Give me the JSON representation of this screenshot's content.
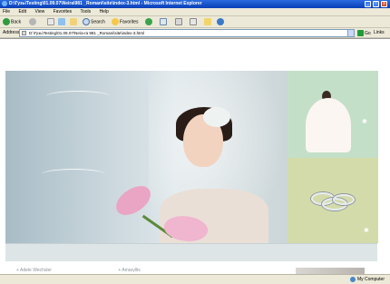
{
  "window": {
    "title": "D:\\Гузь\\Testing\\01.09.07\\Neira\\981 _Romani\\site\\index-3.html - Microsoft Internet Explorer",
    "minimize": "_",
    "maximize": "□",
    "close": "x"
  },
  "menu": [
    "File",
    "Edit",
    "View",
    "Favorites",
    "Tools",
    "Help"
  ],
  "toolbar": {
    "back": "Back",
    "search": "Search",
    "favorites": "Favorites"
  },
  "address": {
    "label": "Address",
    "value": "D:\\Гузь\\Testing\\01.09.07\\Ne\\a-ra 981 _Romani\\site\\index-3.html",
    "go": "Go",
    "links": "Links"
  },
  "page": {
    "footer_links": [
      "Adele Wechsler",
      "Amaryllis"
    ]
  },
  "status": {
    "zone": "My Computer"
  },
  "colors": {
    "titlebar": "#0a3fb8",
    "chrome": "#ece9d8",
    "side_green": "#c4dfc8",
    "side_olive": "#d3dbab"
  }
}
